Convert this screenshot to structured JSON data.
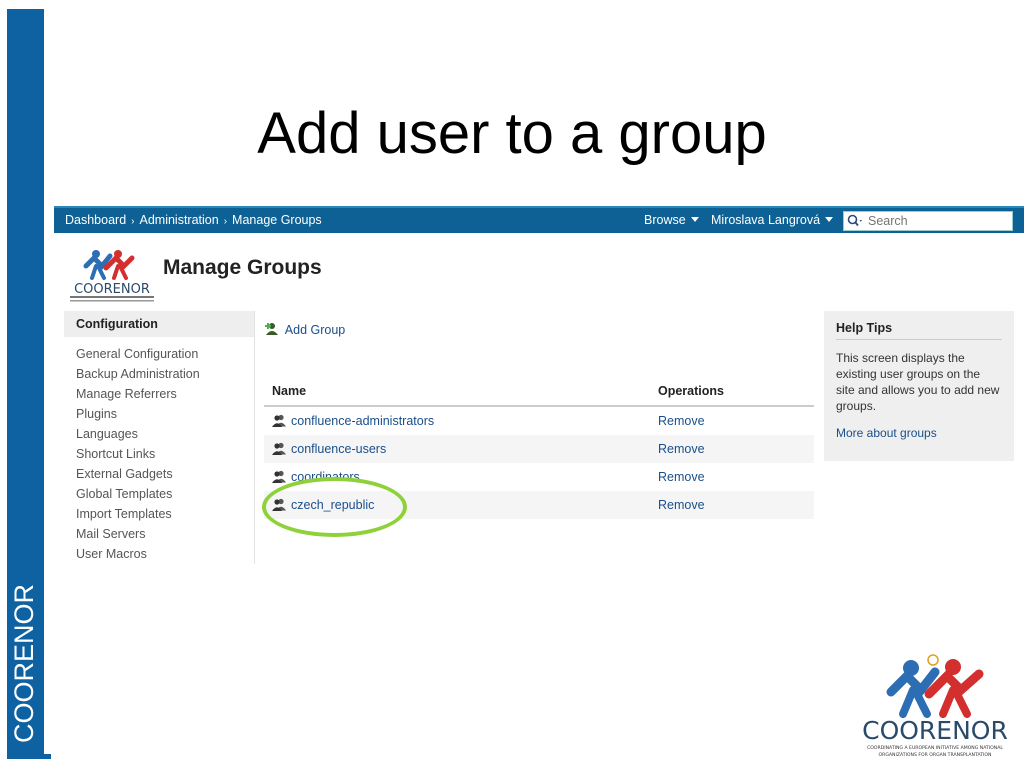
{
  "slide": {
    "title": "Add user to a group",
    "side_label": "COORENOR"
  },
  "topbar": {
    "breadcrumbs": [
      "Dashboard",
      "Administration",
      "Manage Groups"
    ],
    "browse_label": "Browse",
    "user_label": "Miroslava Langrová",
    "search_placeholder": "Search"
  },
  "header": {
    "page_title": "Manage Groups",
    "logo_text": "COORENOR"
  },
  "config": {
    "title": "Configuration",
    "items": [
      "General Configuration",
      "Backup Administration",
      "Manage Referrers",
      "Plugins",
      "Languages",
      "Shortcut Links",
      "External Gadgets",
      "Global Templates",
      "Import Templates",
      "Mail Servers",
      "User Macros"
    ]
  },
  "main": {
    "add_group_label": "Add Group",
    "columns": [
      "Name",
      "Operations"
    ],
    "rows": [
      {
        "name": "confluence-administrators",
        "operation": "Remove"
      },
      {
        "name": "confluence-users",
        "operation": "Remove"
      },
      {
        "name": "coordinators",
        "operation": "Remove"
      },
      {
        "name": "czech_republic",
        "operation": "Remove"
      }
    ]
  },
  "help": {
    "title": "Help Tips",
    "text": "This screen displays the existing user groups on the site and allows you to add new groups.",
    "link": "More about groups"
  },
  "footer_logo": {
    "text": "COORENOR",
    "tagline1": "COORDINATING A EUROPEAN INITIATIVE AMONG NATIONAL",
    "tagline2": "ORGANIZATIONS FOR ORGAN TRANSPLANTATION"
  },
  "colors": {
    "slide_blue": "#0f62a2",
    "topbar_blue": "#0e6194",
    "link_blue": "#1a4f8b",
    "highlight_green": "#8fd13a",
    "logo_red": "#d32f2f"
  }
}
